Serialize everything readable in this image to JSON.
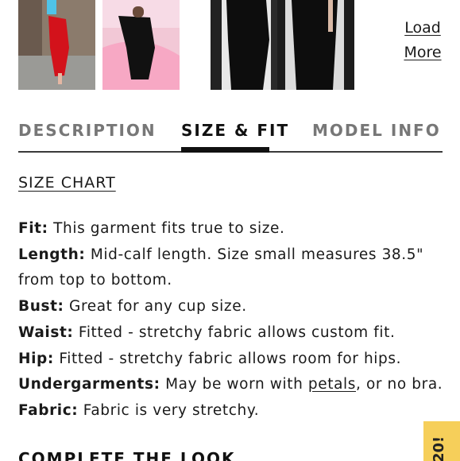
{
  "gallery": {
    "load_more_line1": "Load",
    "load_more_line2": "More"
  },
  "tabs": [
    {
      "label": "DESCRIPTION"
    },
    {
      "label": "SIZE & FIT"
    },
    {
      "label": "MODEL INFO"
    }
  ],
  "size_chart_link": "SIZE CHART",
  "details": {
    "fit_label": "Fit:",
    "fit_text": " This garment fits true to size.",
    "length_label": "Length:",
    "length_text": " Mid-calf length. Size small measures 38.5\" from top to bottom.",
    "bust_label": "Bust:",
    "bust_text": " Great for any cup size.",
    "waist_label": "Waist:",
    "waist_text": " Fitted - stretchy fabric allows custom fit.",
    "hip_label": "Hip:",
    "hip_text": " Fitted - stretchy fabric allows room for hips.",
    "undergarments_label": "Undergarments:",
    "undergarments_text_before": " May be worn with ",
    "undergarments_link": "petals",
    "undergarments_text_after": ", or no bra.",
    "fabric_label": "Fabric:",
    "fabric_text": " Fabric is very stretchy."
  },
  "complete_the_look": "COMPLETE THE LOOK",
  "promo_tab": "20!",
  "colors": {
    "active_tab": "#111111",
    "inactive_tab": "#777777",
    "promo_bg": "#f6cf5a"
  }
}
